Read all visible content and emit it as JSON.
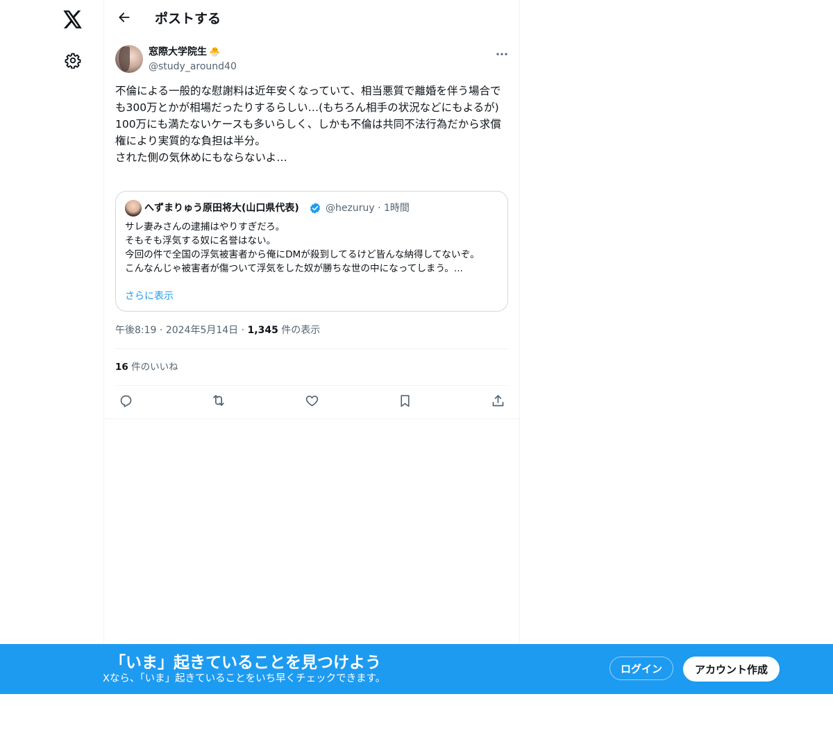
{
  "header": {
    "title": "ポストする"
  },
  "post": {
    "author": {
      "display_name": "窓際大学院生",
      "emoji": "🐣",
      "handle": "@study_around40"
    },
    "text": "不倫による一般的な慰謝料は近年安くなっていて、相当悪質で離婚を伴う場合でも300万とかが相場だったりするらしい…(もちろん相手の状況などにもよるが)\n100万にも満たないケースも多いらしく、しかも不倫は共同不法行為だから求償権により実質的な負担は半分。\nされた側の気休めにもならないよ…",
    "quote": {
      "display_name": "へずまりゅう原田将大(山口県代表)",
      "handle": "@hezuruy",
      "separator": "·",
      "time": "1時間",
      "text": "サレ妻みさんの逮捕はやりすぎだろ。\nそもそも浮気する奴に名誉はない。\n今回の件で全国の浮気被害者から俺にDMが殺到してるけど皆んな納得してないぞ。\nこんなんじゃ被害者が傷ついて浮気をした奴が勝ちな世の中になってしまう。...",
      "show_more": "さらに表示"
    },
    "time": "午後8:19",
    "date": "2024年5月14日",
    "dot": "·",
    "views_count": "1,345",
    "views_label": "件の表示",
    "likes_count": "16",
    "likes_label": "件のいいね"
  },
  "icons": {
    "logo": "x-logo-icon",
    "settings": "gear-icon",
    "back": "arrow-left-icon",
    "more": "more-horizontal-icon",
    "verified": "verified-badge-icon",
    "reply": "reply-icon",
    "repost": "repost-icon",
    "like": "heart-icon",
    "bookmark": "bookmark-icon",
    "share": "share-icon"
  },
  "banner": {
    "title": "「いま」起きていることを見つけよう",
    "subtitle": "Xなら、「いま」起きていることをいち早くチェックできます。",
    "login_label": "ログイン",
    "signup_label": "アカウント作成"
  },
  "colors": {
    "accent": "#1d9bf0",
    "text": "#0f1419",
    "muted": "#536471",
    "border": "#eff3f4"
  }
}
